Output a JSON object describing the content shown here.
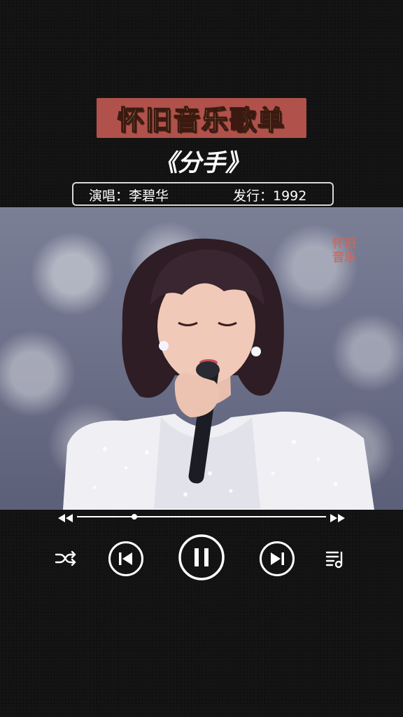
{
  "header": {
    "banner": "怀旧音乐歌单",
    "song_title": "《分手》",
    "singer": "演唱：李碧华",
    "release": "发行：1992"
  },
  "video": {
    "watermark_line1": "怀旧",
    "watermark_line2": "音乐"
  },
  "player": {
    "progress": 0.23,
    "state": "playing",
    "buttons": [
      "shuffle-icon",
      "previous-icon",
      "pause-icon",
      "next-icon",
      "playlist-icon"
    ],
    "seek_icons": [
      "rewind-icon",
      "fast-forward-icon"
    ]
  },
  "colors": {
    "background": "#111111",
    "banner_bg": "#b0514b",
    "banner_text": "#fff6cf",
    "watermark": "#c46b62",
    "controls": "#ffffff"
  }
}
